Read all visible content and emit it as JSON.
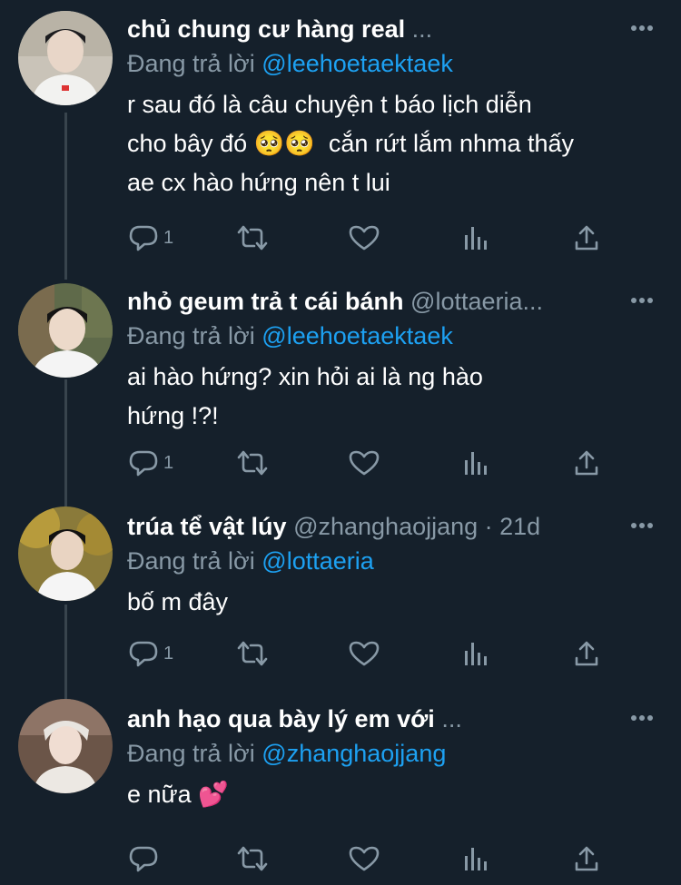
{
  "tweets": [
    {
      "name": "chủ chung cư hàng real",
      "handle": "...",
      "replying_prefix": "Đang trả lời",
      "replying_to": "@leehoetaektaek",
      "text": "r sau đó là câu chuyện t báo lịch diễn\ncho bây đó 🥺🥺  cắn rứt lắm nhma thấy\nae cx hào hứng nên t lui",
      "reply_count": "1",
      "retweet_count": "",
      "like_count": ""
    },
    {
      "name": "nhỏ geum trả t cái bánh",
      "handle": "@lottaeria...",
      "replying_prefix": "Đang trả lời",
      "replying_to": "@leehoetaektaek",
      "text": "ai hào hứng? xin hỏi ai là ng hào\nhứng !?!",
      "reply_count": "1",
      "retweet_count": "",
      "like_count": ""
    },
    {
      "name": "trúa tể vật lúy",
      "handle": "@zhanghaojjang · 21d",
      "replying_prefix": "Đang trả lời",
      "replying_to": "@lottaeria",
      "text": "bố m đây",
      "reply_count": "1",
      "retweet_count": "",
      "like_count": ""
    },
    {
      "name": "anh hạo qua bày lý em với",
      "handle": "...",
      "replying_prefix": "Đang trả lời",
      "replying_to": "@zhanghaojjang",
      "text": "e nữa 💕",
      "reply_count": "",
      "retweet_count": "",
      "like_count": ""
    }
  ],
  "icons": {
    "reply": "reply-icon",
    "retweet": "retweet-icon",
    "like": "heart-icon",
    "analytics": "analytics-icon",
    "share": "share-icon",
    "more": "more-icon"
  },
  "colors": {
    "background": "#15202b",
    "secondary_text": "#8899a6",
    "mention": "#1da1f2",
    "thread_line": "#38444d"
  }
}
